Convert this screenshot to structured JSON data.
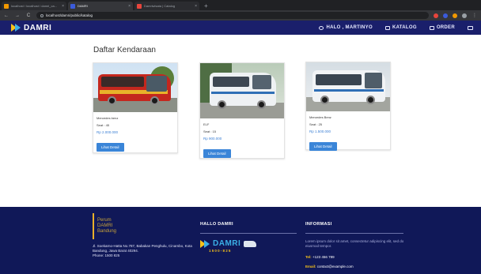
{
  "browser": {
    "tabs": [
      {
        "title": "localhost / localhost / damri_ca...",
        "active": false,
        "favicon_color": "#f29900"
      },
      {
        "title": "DAMRI",
        "active": true,
        "favicon_color": "#3b5bdb"
      },
      {
        "title": "Damriwisata | Catalog",
        "active": false,
        "favicon_color": "#e8453c"
      }
    ],
    "new_tab": "+",
    "url": "localhost/damri/public/katalog",
    "nav": {
      "back": "←",
      "forward": "→",
      "reload": "C"
    }
  },
  "navbar": {
    "logo_text": "DAMRI",
    "links": [
      {
        "label": "HALO , MARTINYO",
        "icon": "user-icon"
      },
      {
        "label": "KATALOG",
        "icon": "catalog-icon"
      },
      {
        "label": "ORDER",
        "icon": "cart-icon"
      },
      {
        "label": "",
        "icon": "logout-icon"
      }
    ]
  },
  "main": {
    "heading": "Daftar Kendaraan",
    "cards": [
      {
        "name": "Mercedes benz",
        "seat": "Seat : 45",
        "price": "Rp 2.000.000",
        "button": "Lihat Detail",
        "image": "red-bus-image"
      },
      {
        "name": "ELF",
        "seat": "Seat : 15",
        "price": "Rp 900.000",
        "button": "Lihat Detail",
        "image": "white-minibus-image"
      },
      {
        "name": "Mercedes Benz",
        "seat": "Seat : 25",
        "price": "Rp 1.500.000",
        "button": "Lihat Detail",
        "image": "white-medium-bus-image"
      }
    ]
  },
  "footer": {
    "brand_lines": [
      "Perum",
      "DAMRI",
      "Bandung"
    ],
    "address": "Jl. Soekarno-Hatta No.787, Babakan Penghulu, Cinambo, Kota Bandung, Jawa Barat 40294.",
    "phone": "Phone: 1500 825",
    "col2_heading": "HALLO DAMRI",
    "logo_text": "DAMRI",
    "logo_phone": "1500-825",
    "col3_heading": "INFORMASI",
    "info_text": "Lorem ipsum dolor sit amet, consectetur adipiscing elit, sed do eiusmod tempor.",
    "tel_label": "Tel:",
    "tel_value": "+123 456 789",
    "email_label": "Email:",
    "email_value": "contact@example.com"
  },
  "colors": {
    "navbar_bg": "#1a1f6b",
    "footer_bg": "#101858",
    "button_blue": "#3a85d8",
    "price_blue": "#3b7fd4",
    "brand_yellow": "#f6c21a",
    "brand_cyan": "#3bb0e6"
  }
}
